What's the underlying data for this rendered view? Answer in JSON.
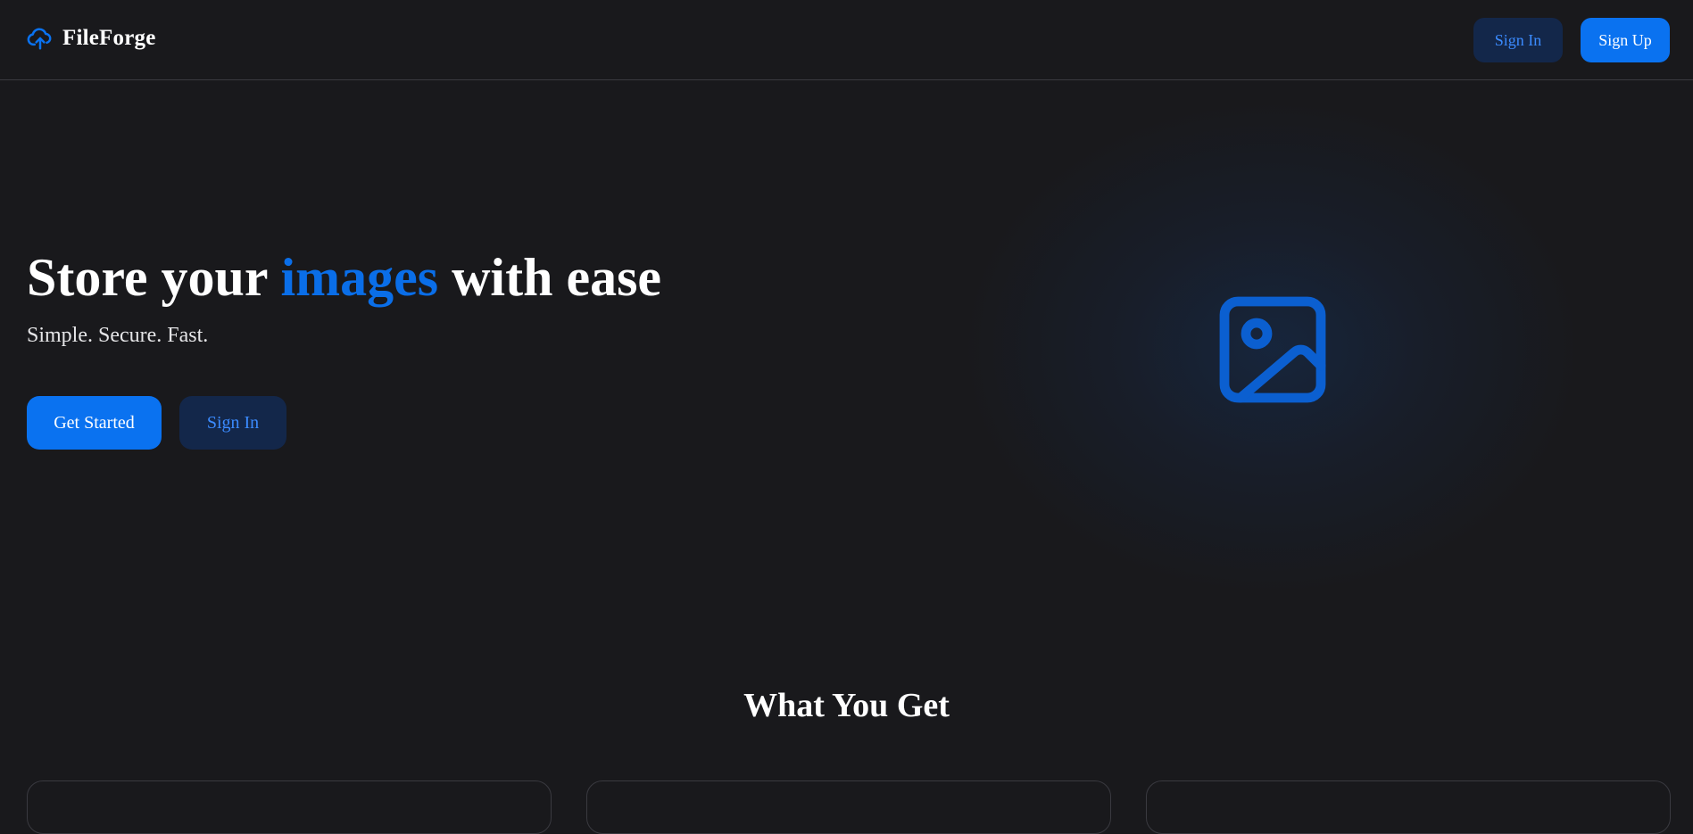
{
  "header": {
    "brand_name": "FileForge",
    "logo_icon": "cloud-upload-icon",
    "sign_in_label": "Sign In",
    "sign_up_label": "Sign Up"
  },
  "hero": {
    "title_prefix": "Store your ",
    "title_accent": "images",
    "title_suffix": " with ease",
    "subtitle": "Simple. Secure. Fast.",
    "primary_button": "Get Started",
    "secondary_button": "Sign In",
    "illustration_icon": "image-icon"
  },
  "features": {
    "heading": "What You Get"
  },
  "colors": {
    "background": "#19191c",
    "accent": "#0a72f0",
    "accent_text": "#3b8bff",
    "secondary_button_bg": "#13274a",
    "border": "#3a3a40"
  }
}
